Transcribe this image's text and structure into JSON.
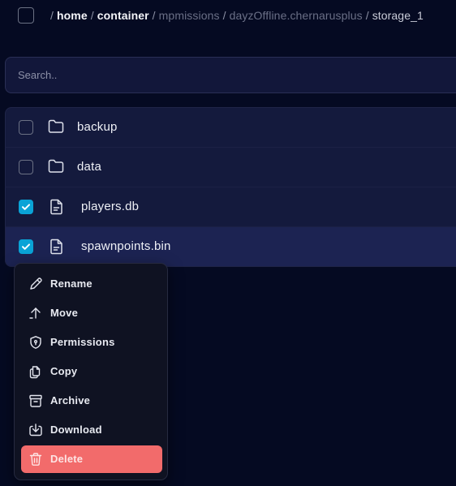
{
  "breadcrumb": [
    {
      "label": "home"
    },
    {
      "label": "container"
    },
    {
      "label": "mpmissions"
    },
    {
      "label": "dayzOffline.chernarusplus"
    },
    {
      "label": "storage_1"
    }
  ],
  "search": {
    "placeholder": "Search.."
  },
  "files": [
    {
      "name": "backup",
      "type": "folder",
      "checked": false
    },
    {
      "name": "data",
      "type": "folder",
      "checked": false
    },
    {
      "name": "players.db",
      "type": "file",
      "checked": true
    },
    {
      "name": "spawnpoints.bin",
      "type": "file",
      "checked": true
    }
  ],
  "context_menu": {
    "items": [
      {
        "label": "Rename",
        "icon": "pencil-icon"
      },
      {
        "label": "Move",
        "icon": "arrow-up-icon"
      },
      {
        "label": "Permissions",
        "icon": "shield-icon"
      },
      {
        "label": "Copy",
        "icon": "copy-icon"
      },
      {
        "label": "Archive",
        "icon": "archive-icon"
      },
      {
        "label": "Download",
        "icon": "download-icon"
      },
      {
        "label": "Delete",
        "icon": "trash-icon"
      }
    ]
  },
  "colors": {
    "background": "#050a22",
    "checkbox_checked": "#0aa3d6",
    "danger": "#f26b6b"
  }
}
